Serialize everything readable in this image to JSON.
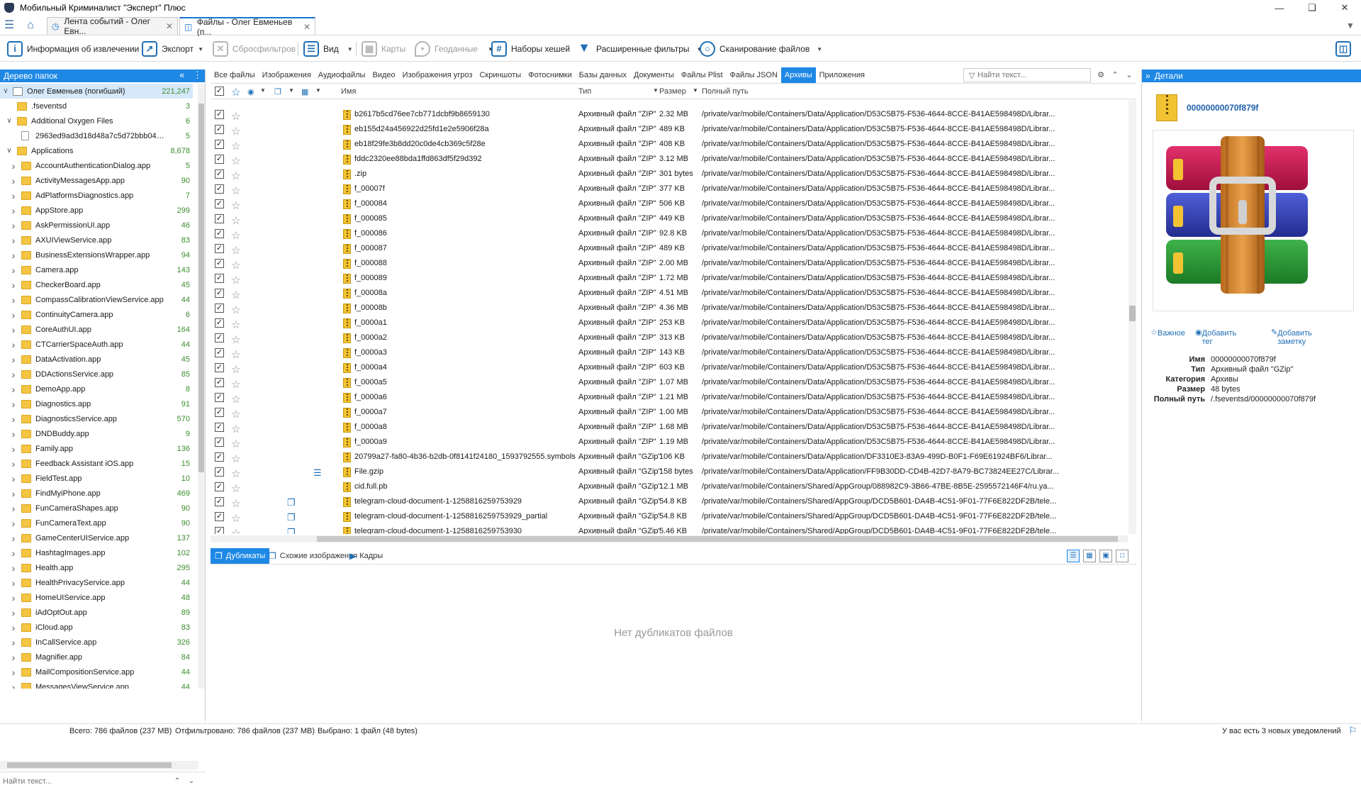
{
  "window": {
    "title": "Мобильный Криминалист \"Эксперт\" Плюс"
  },
  "tabs": [
    {
      "label": "Лента событий - Олег Евн...",
      "active": false
    },
    {
      "label": "Файлы - Олег Евменьев (п...",
      "active": true
    }
  ],
  "toolbar": {
    "extraction_info": "Информация об извлечении",
    "export": "Экспорт",
    "reset_filters": "Сбросфильтров",
    "view": "Вид",
    "maps": "Карты",
    "geodata": "Геоданные",
    "hash_sets": "Наборы хешей",
    "ext_filters": "Расширенные фильтры",
    "scan_files": "Сканирование файлов"
  },
  "left_panel": {
    "title": "Дерево папок",
    "search_placeholder": "Найти текст...",
    "tree": [
      {
        "label": "Олег Евменьев (погибший)",
        "count": "221,247",
        "level": 0,
        "kind": "user",
        "expand": "v",
        "selected": true
      },
      {
        "label": ".fseventsd",
        "count": "3",
        "level": 1,
        "kind": "folder",
        "expand": ""
      },
      {
        "label": "Additional Oxygen Files",
        "count": "6",
        "level": 1,
        "kind": "folder",
        "expand": "v"
      },
      {
        "label": "2963ed9ad3d18d48a7c5d72bbb04a229ff...",
        "count": "5",
        "level": 2,
        "kind": "file",
        "expand": ""
      },
      {
        "label": "Applications",
        "count": "8,678",
        "level": 1,
        "kind": "folder",
        "expand": "v"
      },
      {
        "label": "AccountAuthenticationDialog.app",
        "count": "5",
        "level": 2,
        "kind": "folder",
        "expand": ">"
      },
      {
        "label": "ActivityMessagesApp.app",
        "count": "90",
        "level": 2,
        "kind": "folder",
        "expand": ">"
      },
      {
        "label": "AdPlatformsDiagnostics.app",
        "count": "7",
        "level": 2,
        "kind": "folder",
        "expand": ">"
      },
      {
        "label": "AppStore.app",
        "count": "299",
        "level": 2,
        "kind": "folder",
        "expand": ">"
      },
      {
        "label": "AskPermissionUI.app",
        "count": "46",
        "level": 2,
        "kind": "folder",
        "expand": ">"
      },
      {
        "label": "AXUIViewService.app",
        "count": "83",
        "level": 2,
        "kind": "folder",
        "expand": ">"
      },
      {
        "label": "BusinessExtensionsWrapper.app",
        "count": "94",
        "level": 2,
        "kind": "folder",
        "expand": ">"
      },
      {
        "label": "Camera.app",
        "count": "143",
        "level": 2,
        "kind": "folder",
        "expand": ">"
      },
      {
        "label": "CheckerBoard.app",
        "count": "45",
        "level": 2,
        "kind": "folder",
        "expand": ">"
      },
      {
        "label": "CompassCalibrationViewService.app",
        "count": "44",
        "level": 2,
        "kind": "folder",
        "expand": ">"
      },
      {
        "label": "ContinuityCamera.app",
        "count": "6",
        "level": 2,
        "kind": "folder",
        "expand": ">"
      },
      {
        "label": "CoreAuthUI.app",
        "count": "164",
        "level": 2,
        "kind": "folder",
        "expand": ">"
      },
      {
        "label": "CTCarrierSpaceAuth.app",
        "count": "44",
        "level": 2,
        "kind": "folder",
        "expand": ">"
      },
      {
        "label": "DataActivation.app",
        "count": "45",
        "level": 2,
        "kind": "folder",
        "expand": ">"
      },
      {
        "label": "DDActionsService.app",
        "count": "85",
        "level": 2,
        "kind": "folder",
        "expand": ">"
      },
      {
        "label": "DemoApp.app",
        "count": "8",
        "level": 2,
        "kind": "folder",
        "expand": ">"
      },
      {
        "label": "Diagnostics.app",
        "count": "91",
        "level": 2,
        "kind": "folder",
        "expand": ">"
      },
      {
        "label": "DiagnosticsService.app",
        "count": "570",
        "level": 2,
        "kind": "folder",
        "expand": ">"
      },
      {
        "label": "DNDBuddy.app",
        "count": "9",
        "level": 2,
        "kind": "folder",
        "expand": ">"
      },
      {
        "label": "Family.app",
        "count": "136",
        "level": 2,
        "kind": "folder",
        "expand": ">"
      },
      {
        "label": "Feedback Assistant iOS.app",
        "count": "15",
        "level": 2,
        "kind": "folder",
        "expand": ">"
      },
      {
        "label": "FieldTest.app",
        "count": "10",
        "level": 2,
        "kind": "folder",
        "expand": ">"
      },
      {
        "label": "FindMyiPhone.app",
        "count": "469",
        "level": 2,
        "kind": "folder",
        "expand": ">"
      },
      {
        "label": "FunCameraShapes.app",
        "count": "90",
        "level": 2,
        "kind": "folder",
        "expand": ">"
      },
      {
        "label": "FunCameraText.app",
        "count": "90",
        "level": 2,
        "kind": "folder",
        "expand": ">"
      },
      {
        "label": "GameCenterUIService.app",
        "count": "137",
        "level": 2,
        "kind": "folder",
        "expand": ">"
      },
      {
        "label": "HashtagImages.app",
        "count": "102",
        "level": 2,
        "kind": "folder",
        "expand": ">"
      },
      {
        "label": "Health.app",
        "count": "295",
        "level": 2,
        "kind": "folder",
        "expand": ">"
      },
      {
        "label": "HealthPrivacyService.app",
        "count": "44",
        "level": 2,
        "kind": "folder",
        "expand": ">"
      },
      {
        "label": "HomeUIService.app",
        "count": "48",
        "level": 2,
        "kind": "folder",
        "expand": ">"
      },
      {
        "label": "iAdOptOut.app",
        "count": "89",
        "level": 2,
        "kind": "folder",
        "expand": ">"
      },
      {
        "label": "iCloud.app",
        "count": "83",
        "level": 2,
        "kind": "folder",
        "expand": ">"
      },
      {
        "label": "InCallService.app",
        "count": "326",
        "level": 2,
        "kind": "folder",
        "expand": ">"
      },
      {
        "label": "Magnifier.app",
        "count": "84",
        "level": 2,
        "kind": "folder",
        "expand": ">"
      },
      {
        "label": "MailCompositionService.app",
        "count": "44",
        "level": 2,
        "kind": "folder",
        "expand": ">"
      },
      {
        "label": "MessagesViewService.app",
        "count": "44",
        "level": 2,
        "kind": "folder",
        "expand": ">"
      }
    ]
  },
  "categories": [
    {
      "label": "Все файлы",
      "active": false
    },
    {
      "label": "Изображения",
      "active": false
    },
    {
      "label": "Аудиофайлы",
      "active": false
    },
    {
      "label": "Видео",
      "active": false
    },
    {
      "label": "Изображения угроз",
      "active": false
    },
    {
      "label": "Скриншоты",
      "active": false
    },
    {
      "label": "Фотоснимки",
      "active": false
    },
    {
      "label": "Базы данных",
      "active": false
    },
    {
      "label": "Документы",
      "active": false
    },
    {
      "label": "Файлы Plist",
      "active": false
    },
    {
      "label": "Файлы JSON",
      "active": false
    },
    {
      "label": "Архивы",
      "active": true
    },
    {
      "label": "Приложения",
      "active": false
    }
  ],
  "find_placeholder": "Найти текст...",
  "columns": {
    "name": "Имя",
    "type": "Тип",
    "size": "Размер",
    "path": "Полный путь"
  },
  "rows": [
    {
      "name": "b2617b5cd76ee7cb771dcbf9b8659130",
      "type": "Архивный файл \"ZIP\"",
      "size": "2.32 MB",
      "path": "/private/var/mobile/Containers/Data/Application/D53C5B75-F536-4644-8CCE-B41AE598498D/Librar...",
      "ext": ""
    },
    {
      "name": "eb155d24a456922d25fd1e2e5906f28a",
      "type": "Архивный файл \"ZIP\"",
      "size": "489 KB",
      "path": "/private/var/mobile/Containers/Data/Application/D53C5B75-F536-4644-8CCE-B41AE598498D/Librar...",
      "ext": ""
    },
    {
      "name": "eb18f29fe3b8dd20c0de4cb369c5f28e",
      "type": "Архивный файл \"ZIP\"",
      "size": "408 KB",
      "path": "/private/var/mobile/Containers/Data/Application/D53C5B75-F536-4644-8CCE-B41AE598498D/Librar...",
      "ext": ""
    },
    {
      "name": "fddc2320ee88bda1ffd863df5f29d392",
      "type": "Архивный файл \"ZIP\"",
      "size": "3.12 MB",
      "path": "/private/var/mobile/Containers/Data/Application/D53C5B75-F536-4644-8CCE-B41AE598498D/Librar...",
      "ext": ""
    },
    {
      "name": ".zip",
      "type": "Архивный файл \"ZIP\"",
      "size": "301 bytes",
      "path": "/private/var/mobile/Containers/Data/Application/D53C5B75-F536-4644-8CCE-B41AE598498D/Librar...",
      "ext": ""
    },
    {
      "name": "f_00007f",
      "type": "Архивный файл \"ZIP\"",
      "size": "377 KB",
      "path": "/private/var/mobile/Containers/Data/Application/D53C5B75-F536-4644-8CCE-B41AE598498D/Librar...",
      "ext": ""
    },
    {
      "name": "f_000084",
      "type": "Архивный файл \"ZIP\"",
      "size": "506 KB",
      "path": "/private/var/mobile/Containers/Data/Application/D53C5B75-F536-4644-8CCE-B41AE598498D/Librar...",
      "ext": ""
    },
    {
      "name": "f_000085",
      "type": "Архивный файл \"ZIP\"",
      "size": "449 KB",
      "path": "/private/var/mobile/Containers/Data/Application/D53C5B75-F536-4644-8CCE-B41AE598498D/Librar...",
      "ext": ""
    },
    {
      "name": "f_000086",
      "type": "Архивный файл \"ZIP\"",
      "size": "92.8 KB",
      "path": "/private/var/mobile/Containers/Data/Application/D53C5B75-F536-4644-8CCE-B41AE598498D/Librar...",
      "ext": ""
    },
    {
      "name": "f_000087",
      "type": "Архивный файл \"ZIP\"",
      "size": "489 KB",
      "path": "/private/var/mobile/Containers/Data/Application/D53C5B75-F536-4644-8CCE-B41AE598498D/Librar...",
      "ext": ""
    },
    {
      "name": "f_000088",
      "type": "Архивный файл \"ZIP\"",
      "size": "2.00 MB",
      "path": "/private/var/mobile/Containers/Data/Application/D53C5B75-F536-4644-8CCE-B41AE598498D/Librar...",
      "ext": ""
    },
    {
      "name": "f_000089",
      "type": "Архивный файл \"ZIP\"",
      "size": "1.72 MB",
      "path": "/private/var/mobile/Containers/Data/Application/D53C5B75-F536-4644-8CCE-B41AE598498D/Librar...",
      "ext": ""
    },
    {
      "name": "f_00008a",
      "type": "Архивный файл \"ZIP\"",
      "size": "4.51 MB",
      "path": "/private/var/mobile/Containers/Data/Application/D53C5B75-F536-4644-8CCE-B41AE598498D/Librar...",
      "ext": ""
    },
    {
      "name": "f_00008b",
      "type": "Архивный файл \"ZIP\"",
      "size": "4.36 MB",
      "path": "/private/var/mobile/Containers/Data/Application/D53C5B75-F536-4644-8CCE-B41AE598498D/Librar...",
      "ext": ""
    },
    {
      "name": "f_0000a1",
      "type": "Архивный файл \"ZIP\"",
      "size": "253 KB",
      "path": "/private/var/mobile/Containers/Data/Application/D53C5B75-F536-4644-8CCE-B41AE598498D/Librar...",
      "ext": ""
    },
    {
      "name": "f_0000a2",
      "type": "Архивный файл \"ZIP\"",
      "size": "313 KB",
      "path": "/private/var/mobile/Containers/Data/Application/D53C5B75-F536-4644-8CCE-B41AE598498D/Librar...",
      "ext": ""
    },
    {
      "name": "f_0000a3",
      "type": "Архивный файл \"ZIP\"",
      "size": "143 KB",
      "path": "/private/var/mobile/Containers/Data/Application/D53C5B75-F536-4644-8CCE-B41AE598498D/Librar...",
      "ext": ""
    },
    {
      "name": "f_0000a4",
      "type": "Архивный файл \"ZIP\"",
      "size": "603 KB",
      "path": "/private/var/mobile/Containers/Data/Application/D53C5B75-F536-4644-8CCE-B41AE598498D/Librar...",
      "ext": ""
    },
    {
      "name": "f_0000a5",
      "type": "Архивный файл \"ZIP\"",
      "size": "1.07 MB",
      "path": "/private/var/mobile/Containers/Data/Application/D53C5B75-F536-4644-8CCE-B41AE598498D/Librar...",
      "ext": ""
    },
    {
      "name": "f_0000a6",
      "type": "Архивный файл \"ZIP\"",
      "size": "1.21 MB",
      "path": "/private/var/mobile/Containers/Data/Application/D53C5B75-F536-4644-8CCE-B41AE598498D/Librar...",
      "ext": ""
    },
    {
      "name": "f_0000a7",
      "type": "Архивный файл \"ZIP\"",
      "size": "1.00 MB",
      "path": "/private/var/mobile/Containers/Data/Application/D53C5B75-F536-4644-8CCE-B41AE598498D/Librar...",
      "ext": ""
    },
    {
      "name": "f_0000a8",
      "type": "Архивный файл \"ZIP\"",
      "size": "1.68 MB",
      "path": "/private/var/mobile/Containers/Data/Application/D53C5B75-F536-4644-8CCE-B41AE598498D/Librar...",
      "ext": ""
    },
    {
      "name": "f_0000a9",
      "type": "Архивный файл \"ZIP\"",
      "size": "1.19 MB",
      "path": "/private/var/mobile/Containers/Data/Application/D53C5B75-F536-4644-8CCE-B41AE598498D/Librar...",
      "ext": ""
    },
    {
      "name": "20799a27-fa80-4b36-b2db-0f8141f24180_1593792555.symbols",
      "type": "Архивный файл \"GZip\"",
      "size": "106 KB",
      "path": "/private/var/mobile/Containers/Data/Application/DF3310E3-83A9-499D-B0F1-F69E61924BF6/Librar...",
      "ext": ""
    },
    {
      "name": "File.gzip",
      "type": "Архивный файл \"GZip\"",
      "size": "158 bytes",
      "path": "/private/var/mobile/Containers/Data/Application/FF9B30DD-CD4B-42D7-8A79-BC73824EE27C/Librar...",
      "ext": "db"
    },
    {
      "name": "cid.full.pb",
      "type": "Архивный файл \"GZip\"",
      "size": "12.1 MB",
      "path": "/private/var/mobile/Containers/Shared/AppGroup/088982C9-3B66-47BE-8B5E-2595572146F4/ru.ya...",
      "ext": ""
    },
    {
      "name": "telegram-cloud-document-1-1258816259753929",
      "type": "Архивный файл \"GZip\"",
      "size": "54.8 KB",
      "path": "/private/var/mobile/Containers/Shared/AppGroup/DCD5B601-DA4B-4C51-9F01-77F6E822DF2B/tele...",
      "ext": "dup"
    },
    {
      "name": "telegram-cloud-document-1-1258816259753929_partial",
      "type": "Архивный файл \"GZip\"",
      "size": "54.8 KB",
      "path": "/private/var/mobile/Containers/Shared/AppGroup/DCD5B601-DA4B-4C51-9F01-77F6E822DF2B/tele...",
      "ext": "dup"
    },
    {
      "name": "telegram-cloud-document-1-1258816259753930",
      "type": "Архивный файл \"GZip\"",
      "size": "5.46 KB",
      "path": "/private/var/mobile/Containers/Shared/AppGroup/DCD5B601-DA4B-4C51-9F01-77F6E822DF2B/tele...",
      "ext": "dup"
    }
  ],
  "bottom_tabs": [
    "Дубликаты",
    "Схожие изображения",
    "Кадры"
  ],
  "no_duplicates": "Нет дубликатов файлов",
  "details": {
    "title": "Детали",
    "file_name": "00000000070f879f",
    "actions": {
      "important": "Важное",
      "add_tag": "Добавить тег",
      "add_note": "Добавить заметку"
    },
    "props": [
      {
        "key": "Имя",
        "value": "00000000070f879f"
      },
      {
        "key": "Тип",
        "value": "Архивный файл \"GZip\""
      },
      {
        "key": "Категория",
        "value": "Архивы"
      },
      {
        "key": "Размер",
        "value": "48 bytes"
      },
      {
        "key": "Полный путь",
        "value": "/.fseventsd/00000000070f879f"
      }
    ]
  },
  "status": {
    "total": "Всего: 786 файлов (237 МВ)",
    "filtered": "Отфильтровано: 786 файлов (237 МВ)",
    "selected": "Выбрано: 1 файл (48 bytes)",
    "notifications": "У вас есть 3 новых уведомлений"
  },
  "colors": {
    "accent": "#1e88e5",
    "count_green": "#3c8d2f",
    "link_blue": "#1f5fad"
  }
}
